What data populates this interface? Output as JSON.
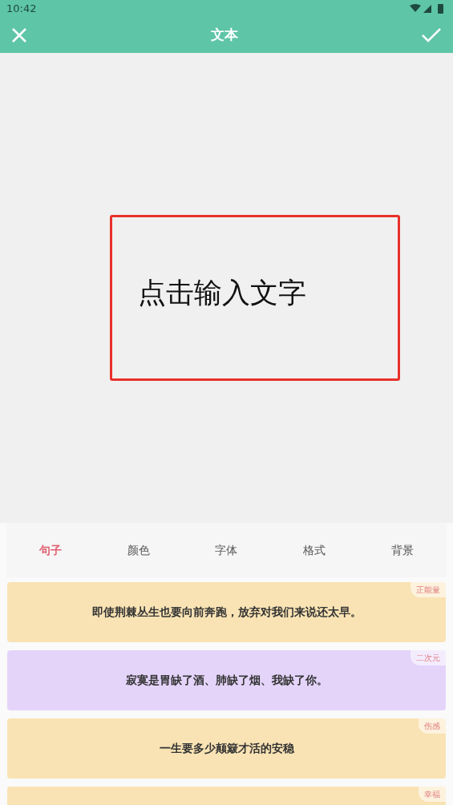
{
  "status_bar": {
    "time": "10:42"
  },
  "toolbar": {
    "title": "文本"
  },
  "canvas": {
    "text": "点击输入文字"
  },
  "tabs": [
    {
      "label": "句子",
      "selected": true
    },
    {
      "label": "颜色",
      "selected": false
    },
    {
      "label": "字体",
      "selected": false
    },
    {
      "label": "格式",
      "selected": false
    },
    {
      "label": "背景",
      "selected": false
    }
  ],
  "sentences": [
    {
      "tag": "正能量",
      "text": "即使荆棘丛生也要向前奔跑，放弃对我们来说还太早。",
      "color": "#f9e3b4"
    },
    {
      "tag": "二次元",
      "text": "寂寞是胃缺了酒、肺缺了烟、我缺了你。",
      "color": "#e4d4fa"
    },
    {
      "tag": "伤感",
      "text": "一生要多少颠簸才活的安稳",
      "color": "#f9e3b4"
    },
    {
      "tag": "幸福",
      "color": "#f9e3b4"
    }
  ]
}
